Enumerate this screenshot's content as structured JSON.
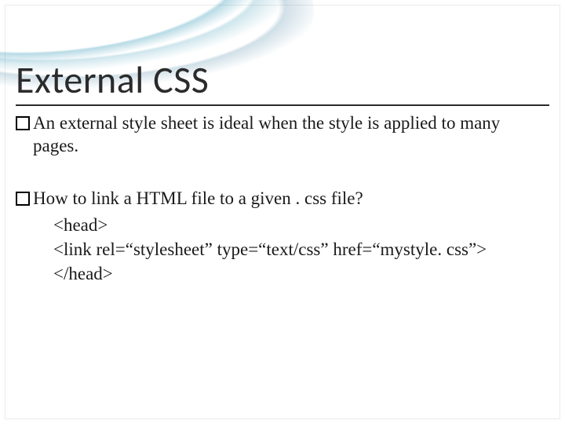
{
  "slide": {
    "title": "External CSS",
    "bullets": [
      "An external style sheet is ideal when the style is applied to many pages.",
      "How to link a HTML file to a given . css file?"
    ],
    "code_lines": [
      "<head>",
      "<link rel=“stylesheet” type=“text/css” href=“mystyle. css”>",
      "</head>"
    ]
  }
}
